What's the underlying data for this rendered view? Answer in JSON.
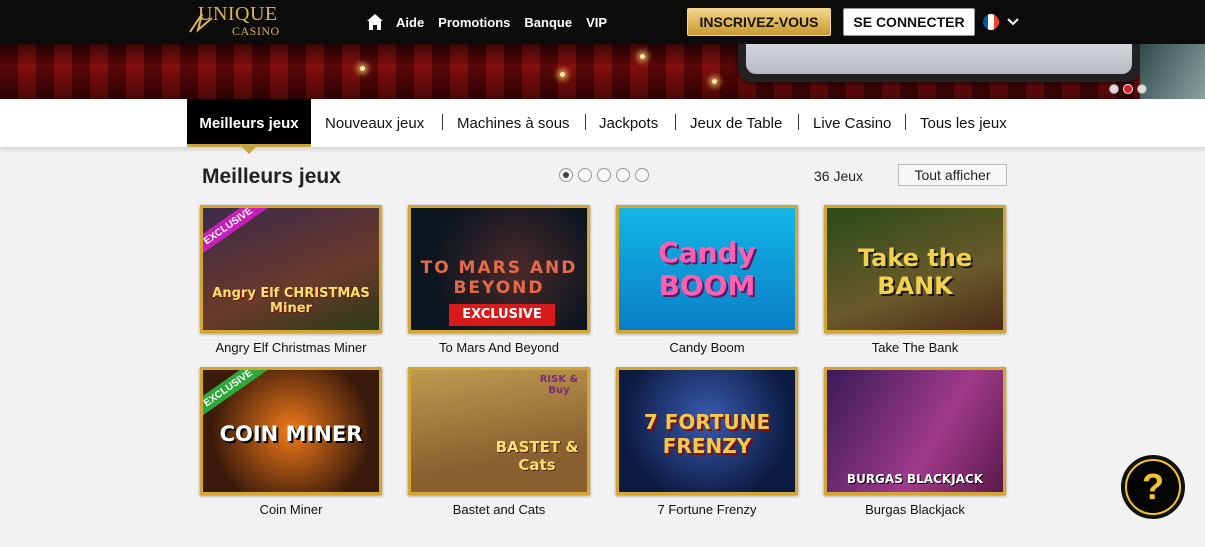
{
  "header": {
    "logo_main": "UNIQUE",
    "logo_sub": "CASINO",
    "nav": [
      "Aide",
      "Promotions",
      "Banque",
      "VIP"
    ],
    "register_label": "INSCRIVEZ-VOUS",
    "login_label": "SE CONNECTER",
    "language_flag_colors": [
      "#0055a4",
      "#ffffff",
      "#ef4135"
    ]
  },
  "banner": {
    "slide_count": 3,
    "active_slide": 2
  },
  "categories": {
    "active": "Meilleurs jeux",
    "items": [
      "Nouveaux jeux",
      "Machines à sous",
      "Jackpots",
      "Jeux de Table",
      "Live Casino",
      "Tous les jeux"
    ]
  },
  "section": {
    "title": "Meilleurs jeux",
    "page_count": 5,
    "active_page": 1,
    "game_count": "36 Jeux",
    "show_all_label": "Tout afficher"
  },
  "games": [
    {
      "name": "Angry Elf Christmas Miner",
      "badge": "EXCLUSIVE",
      "art": "Angry Elf CHRISTMAS Miner"
    },
    {
      "name": "To Mars And Beyond",
      "badge": "EXCLUSIVE",
      "art": "TO MARS AND BEYOND"
    },
    {
      "name": "Candy Boom",
      "badge": "",
      "art": "Candy BOOM"
    },
    {
      "name": "Take The Bank",
      "badge": "",
      "art": "Take the BANK"
    },
    {
      "name": "Coin Miner",
      "badge": "EXCLUSIVE",
      "art": "COIN MINER"
    },
    {
      "name": "Bastet and Cats",
      "badge": "RISK & Buy",
      "art": "BASTET & Cats"
    },
    {
      "name": "7 Fortune Frenzy",
      "badge": "",
      "art": "7 FORTUNE FRENZY"
    },
    {
      "name": "Burgas Blackjack",
      "badge": "",
      "art": "BURGAS BLACKJACK"
    }
  ],
  "help": {
    "symbol": "?"
  },
  "colors": {
    "gold": "#d4a531",
    "dark": "#0c0c0c"
  }
}
